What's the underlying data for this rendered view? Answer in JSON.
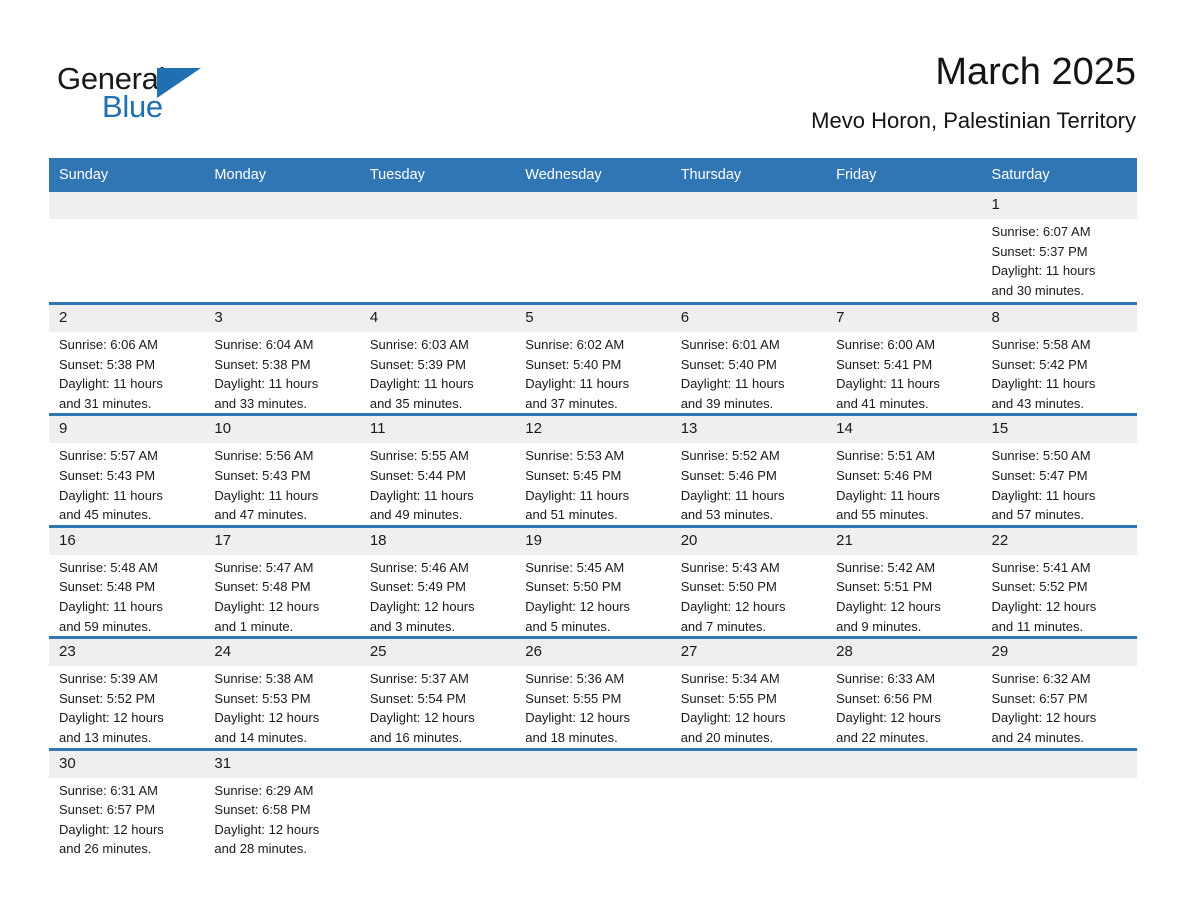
{
  "brand": {
    "name_top": "General",
    "name_bottom": "Blue",
    "accent_color": "#1f6fb2"
  },
  "header": {
    "title": "March 2025",
    "subtitle": "Mevo Horon, Palestinian Territory"
  },
  "theme": {
    "header_blue": "#3075b4",
    "daynum_band": "#efefef",
    "text": "#1a1a1a"
  },
  "weekday_headers": [
    "Sunday",
    "Monday",
    "Tuesday",
    "Wednesday",
    "Thursday",
    "Friday",
    "Saturday"
  ],
  "weeks": [
    [
      {
        "day": "",
        "sunrise": "",
        "sunset": "",
        "daylight_1": "",
        "daylight_2": ""
      },
      {
        "day": "",
        "sunrise": "",
        "sunset": "",
        "daylight_1": "",
        "daylight_2": ""
      },
      {
        "day": "",
        "sunrise": "",
        "sunset": "",
        "daylight_1": "",
        "daylight_2": ""
      },
      {
        "day": "",
        "sunrise": "",
        "sunset": "",
        "daylight_1": "",
        "daylight_2": ""
      },
      {
        "day": "",
        "sunrise": "",
        "sunset": "",
        "daylight_1": "",
        "daylight_2": ""
      },
      {
        "day": "",
        "sunrise": "",
        "sunset": "",
        "daylight_1": "",
        "daylight_2": ""
      },
      {
        "day": "1",
        "sunrise": "Sunrise: 6:07 AM",
        "sunset": "Sunset: 5:37 PM",
        "daylight_1": "Daylight: 11 hours",
        "daylight_2": "and 30 minutes."
      }
    ],
    [
      {
        "day": "2",
        "sunrise": "Sunrise: 6:06 AM",
        "sunset": "Sunset: 5:38 PM",
        "daylight_1": "Daylight: 11 hours",
        "daylight_2": "and 31 minutes."
      },
      {
        "day": "3",
        "sunrise": "Sunrise: 6:04 AM",
        "sunset": "Sunset: 5:38 PM",
        "daylight_1": "Daylight: 11 hours",
        "daylight_2": "and 33 minutes."
      },
      {
        "day": "4",
        "sunrise": "Sunrise: 6:03 AM",
        "sunset": "Sunset: 5:39 PM",
        "daylight_1": "Daylight: 11 hours",
        "daylight_2": "and 35 minutes."
      },
      {
        "day": "5",
        "sunrise": "Sunrise: 6:02 AM",
        "sunset": "Sunset: 5:40 PM",
        "daylight_1": "Daylight: 11 hours",
        "daylight_2": "and 37 minutes."
      },
      {
        "day": "6",
        "sunrise": "Sunrise: 6:01 AM",
        "sunset": "Sunset: 5:40 PM",
        "daylight_1": "Daylight: 11 hours",
        "daylight_2": "and 39 minutes."
      },
      {
        "day": "7",
        "sunrise": "Sunrise: 6:00 AM",
        "sunset": "Sunset: 5:41 PM",
        "daylight_1": "Daylight: 11 hours",
        "daylight_2": "and 41 minutes."
      },
      {
        "day": "8",
        "sunrise": "Sunrise: 5:58 AM",
        "sunset": "Sunset: 5:42 PM",
        "daylight_1": "Daylight: 11 hours",
        "daylight_2": "and 43 minutes."
      }
    ],
    [
      {
        "day": "9",
        "sunrise": "Sunrise: 5:57 AM",
        "sunset": "Sunset: 5:43 PM",
        "daylight_1": "Daylight: 11 hours",
        "daylight_2": "and 45 minutes."
      },
      {
        "day": "10",
        "sunrise": "Sunrise: 5:56 AM",
        "sunset": "Sunset: 5:43 PM",
        "daylight_1": "Daylight: 11 hours",
        "daylight_2": "and 47 minutes."
      },
      {
        "day": "11",
        "sunrise": "Sunrise: 5:55 AM",
        "sunset": "Sunset: 5:44 PM",
        "daylight_1": "Daylight: 11 hours",
        "daylight_2": "and 49 minutes."
      },
      {
        "day": "12",
        "sunrise": "Sunrise: 5:53 AM",
        "sunset": "Sunset: 5:45 PM",
        "daylight_1": "Daylight: 11 hours",
        "daylight_2": "and 51 minutes."
      },
      {
        "day": "13",
        "sunrise": "Sunrise: 5:52 AM",
        "sunset": "Sunset: 5:46 PM",
        "daylight_1": "Daylight: 11 hours",
        "daylight_2": "and 53 minutes."
      },
      {
        "day": "14",
        "sunrise": "Sunrise: 5:51 AM",
        "sunset": "Sunset: 5:46 PM",
        "daylight_1": "Daylight: 11 hours",
        "daylight_2": "and 55 minutes."
      },
      {
        "day": "15",
        "sunrise": "Sunrise: 5:50 AM",
        "sunset": "Sunset: 5:47 PM",
        "daylight_1": "Daylight: 11 hours",
        "daylight_2": "and 57 minutes."
      }
    ],
    [
      {
        "day": "16",
        "sunrise": "Sunrise: 5:48 AM",
        "sunset": "Sunset: 5:48 PM",
        "daylight_1": "Daylight: 11 hours",
        "daylight_2": "and 59 minutes."
      },
      {
        "day": "17",
        "sunrise": "Sunrise: 5:47 AM",
        "sunset": "Sunset: 5:48 PM",
        "daylight_1": "Daylight: 12 hours",
        "daylight_2": "and 1 minute."
      },
      {
        "day": "18",
        "sunrise": "Sunrise: 5:46 AM",
        "sunset": "Sunset: 5:49 PM",
        "daylight_1": "Daylight: 12 hours",
        "daylight_2": "and 3 minutes."
      },
      {
        "day": "19",
        "sunrise": "Sunrise: 5:45 AM",
        "sunset": "Sunset: 5:50 PM",
        "daylight_1": "Daylight: 12 hours",
        "daylight_2": "and 5 minutes."
      },
      {
        "day": "20",
        "sunrise": "Sunrise: 5:43 AM",
        "sunset": "Sunset: 5:50 PM",
        "daylight_1": "Daylight: 12 hours",
        "daylight_2": "and 7 minutes."
      },
      {
        "day": "21",
        "sunrise": "Sunrise: 5:42 AM",
        "sunset": "Sunset: 5:51 PM",
        "daylight_1": "Daylight: 12 hours",
        "daylight_2": "and 9 minutes."
      },
      {
        "day": "22",
        "sunrise": "Sunrise: 5:41 AM",
        "sunset": "Sunset: 5:52 PM",
        "daylight_1": "Daylight: 12 hours",
        "daylight_2": "and 11 minutes."
      }
    ],
    [
      {
        "day": "23",
        "sunrise": "Sunrise: 5:39 AM",
        "sunset": "Sunset: 5:52 PM",
        "daylight_1": "Daylight: 12 hours",
        "daylight_2": "and 13 minutes."
      },
      {
        "day": "24",
        "sunrise": "Sunrise: 5:38 AM",
        "sunset": "Sunset: 5:53 PM",
        "daylight_1": "Daylight: 12 hours",
        "daylight_2": "and 14 minutes."
      },
      {
        "day": "25",
        "sunrise": "Sunrise: 5:37 AM",
        "sunset": "Sunset: 5:54 PM",
        "daylight_1": "Daylight: 12 hours",
        "daylight_2": "and 16 minutes."
      },
      {
        "day": "26",
        "sunrise": "Sunrise: 5:36 AM",
        "sunset": "Sunset: 5:55 PM",
        "daylight_1": "Daylight: 12 hours",
        "daylight_2": "and 18 minutes."
      },
      {
        "day": "27",
        "sunrise": "Sunrise: 5:34 AM",
        "sunset": "Sunset: 5:55 PM",
        "daylight_1": "Daylight: 12 hours",
        "daylight_2": "and 20 minutes."
      },
      {
        "day": "28",
        "sunrise": "Sunrise: 6:33 AM",
        "sunset": "Sunset: 6:56 PM",
        "daylight_1": "Daylight: 12 hours",
        "daylight_2": "and 22 minutes."
      },
      {
        "day": "29",
        "sunrise": "Sunrise: 6:32 AM",
        "sunset": "Sunset: 6:57 PM",
        "daylight_1": "Daylight: 12 hours",
        "daylight_2": "and 24 minutes."
      }
    ],
    [
      {
        "day": "30",
        "sunrise": "Sunrise: 6:31 AM",
        "sunset": "Sunset: 6:57 PM",
        "daylight_1": "Daylight: 12 hours",
        "daylight_2": "and 26 minutes."
      },
      {
        "day": "31",
        "sunrise": "Sunrise: 6:29 AM",
        "sunset": "Sunset: 6:58 PM",
        "daylight_1": "Daylight: 12 hours",
        "daylight_2": "and 28 minutes."
      },
      {
        "day": "",
        "sunrise": "",
        "sunset": "",
        "daylight_1": "",
        "daylight_2": ""
      },
      {
        "day": "",
        "sunrise": "",
        "sunset": "",
        "daylight_1": "",
        "daylight_2": ""
      },
      {
        "day": "",
        "sunrise": "",
        "sunset": "",
        "daylight_1": "",
        "daylight_2": ""
      },
      {
        "day": "",
        "sunrise": "",
        "sunset": "",
        "daylight_1": "",
        "daylight_2": ""
      },
      {
        "day": "",
        "sunrise": "",
        "sunset": "",
        "daylight_1": "",
        "daylight_2": ""
      }
    ]
  ]
}
